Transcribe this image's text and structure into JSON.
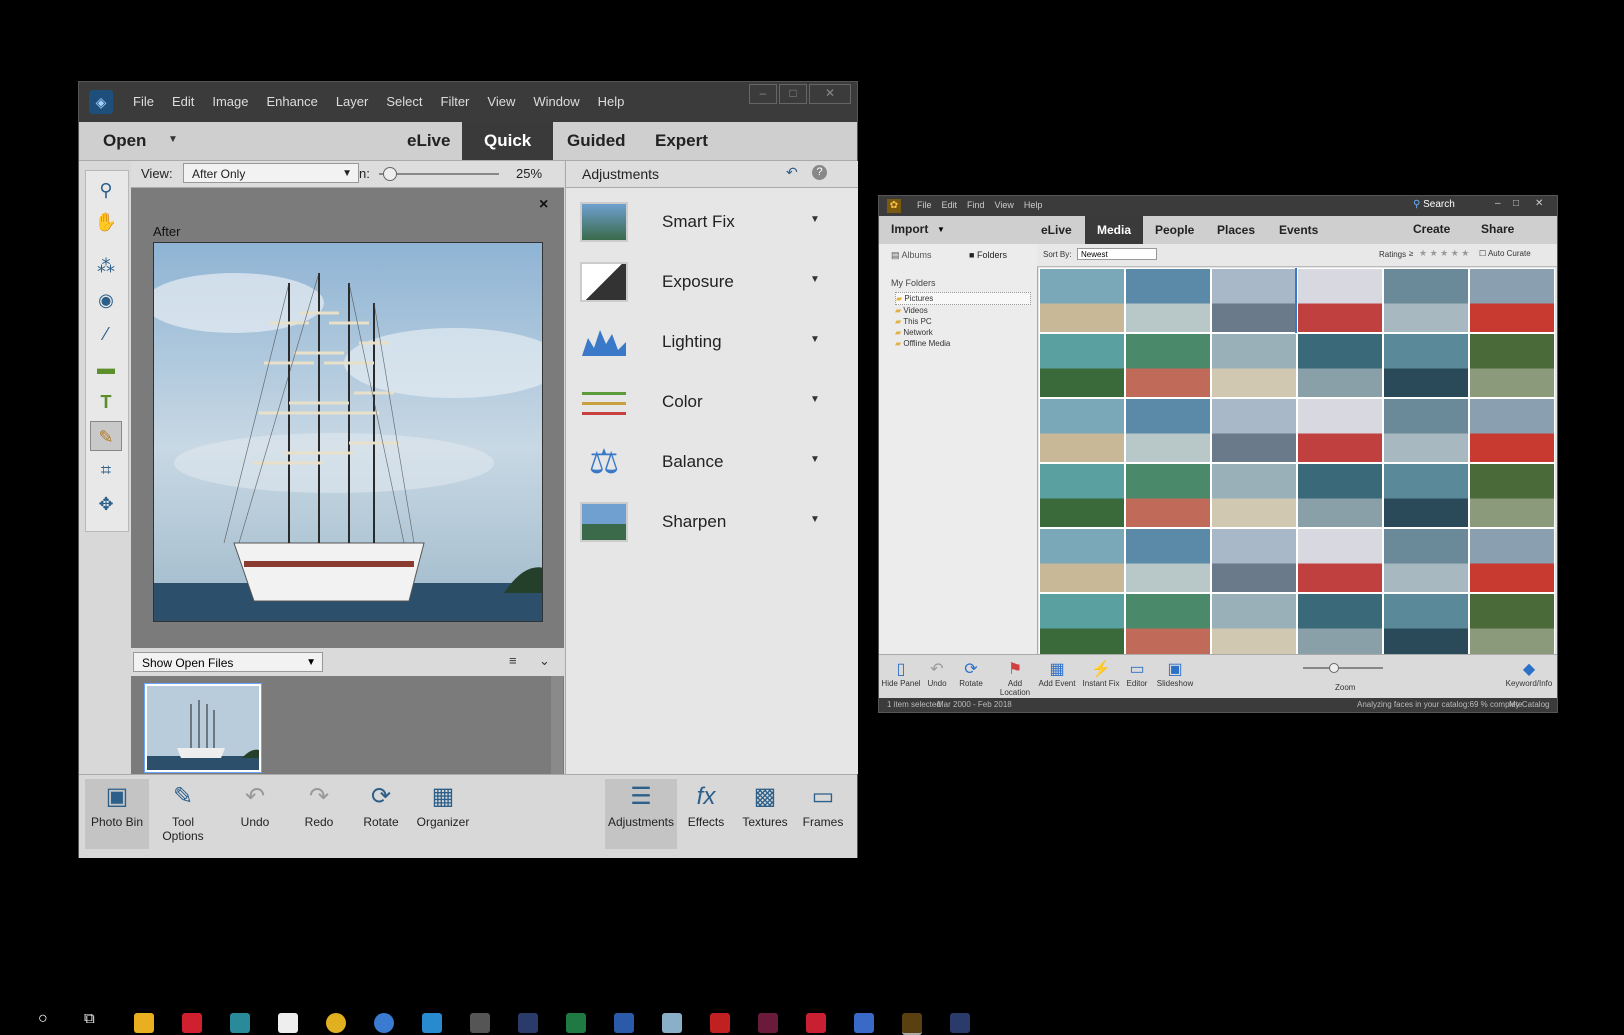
{
  "editor": {
    "menus": [
      "File",
      "Edit",
      "Image",
      "Enhance",
      "Layer",
      "Select",
      "Filter",
      "View",
      "Window",
      "Help"
    ],
    "open_label": "Open",
    "modes": [
      "eLive",
      "Quick",
      "Guided",
      "Expert"
    ],
    "view_label": "View:",
    "view_value": "After Only",
    "zoom_prefix": "n:",
    "zoom_value": "25%",
    "zoom_fraction": 0.08,
    "after_label": "After",
    "close_glyph": "×",
    "bin_select": "Show Open Files",
    "adjustments_title": "Adjustments",
    "adjustments": [
      "Smart Fix",
      "Exposure",
      "Lighting",
      "Color",
      "Balance",
      "Sharpen"
    ],
    "bottom_left": [
      "Photo Bin",
      "Tool Options",
      "Undo",
      "Redo",
      "Rotate",
      "Organizer"
    ],
    "bottom_right": [
      "Adjustments",
      "Effects",
      "Textures",
      "Frames"
    ]
  },
  "organizer": {
    "menus": [
      "File",
      "Edit",
      "Find",
      "View",
      "Help"
    ],
    "search": "Search",
    "import": "Import",
    "tabs": [
      "eLive",
      "Media",
      "People",
      "Places",
      "Events"
    ],
    "create": "Create",
    "share": "Share",
    "albums": "Albums",
    "folders": "Folders",
    "my_folders": "My Folders",
    "tree": [
      "Pictures",
      "Videos",
      "This PC",
      "Network",
      "Offline Media"
    ],
    "sort_by": "Sort By:",
    "sort_value": "Newest",
    "ratings": "Ratings",
    "ratings_op": "≥",
    "auto_curate": "Auto Curate",
    "bottom": [
      "Hide Panel",
      "Undo",
      "Rotate",
      "Add Location",
      "Add Event",
      "Instant Fix",
      "Editor",
      "Slideshow"
    ],
    "zoom": "Zoom",
    "keyword": "Keyword/Info",
    "status_selected": "1 item selected",
    "status_range": "Mar 2000 - Feb 2018",
    "status_faces": "Analyzing faces in your catalog:69 % complete",
    "status_catalog": "My Catalog"
  },
  "colors": {
    "accent": "#2c5f8a",
    "dark_chrome": "#3b3b3b",
    "selected": "#3a3a3a"
  }
}
